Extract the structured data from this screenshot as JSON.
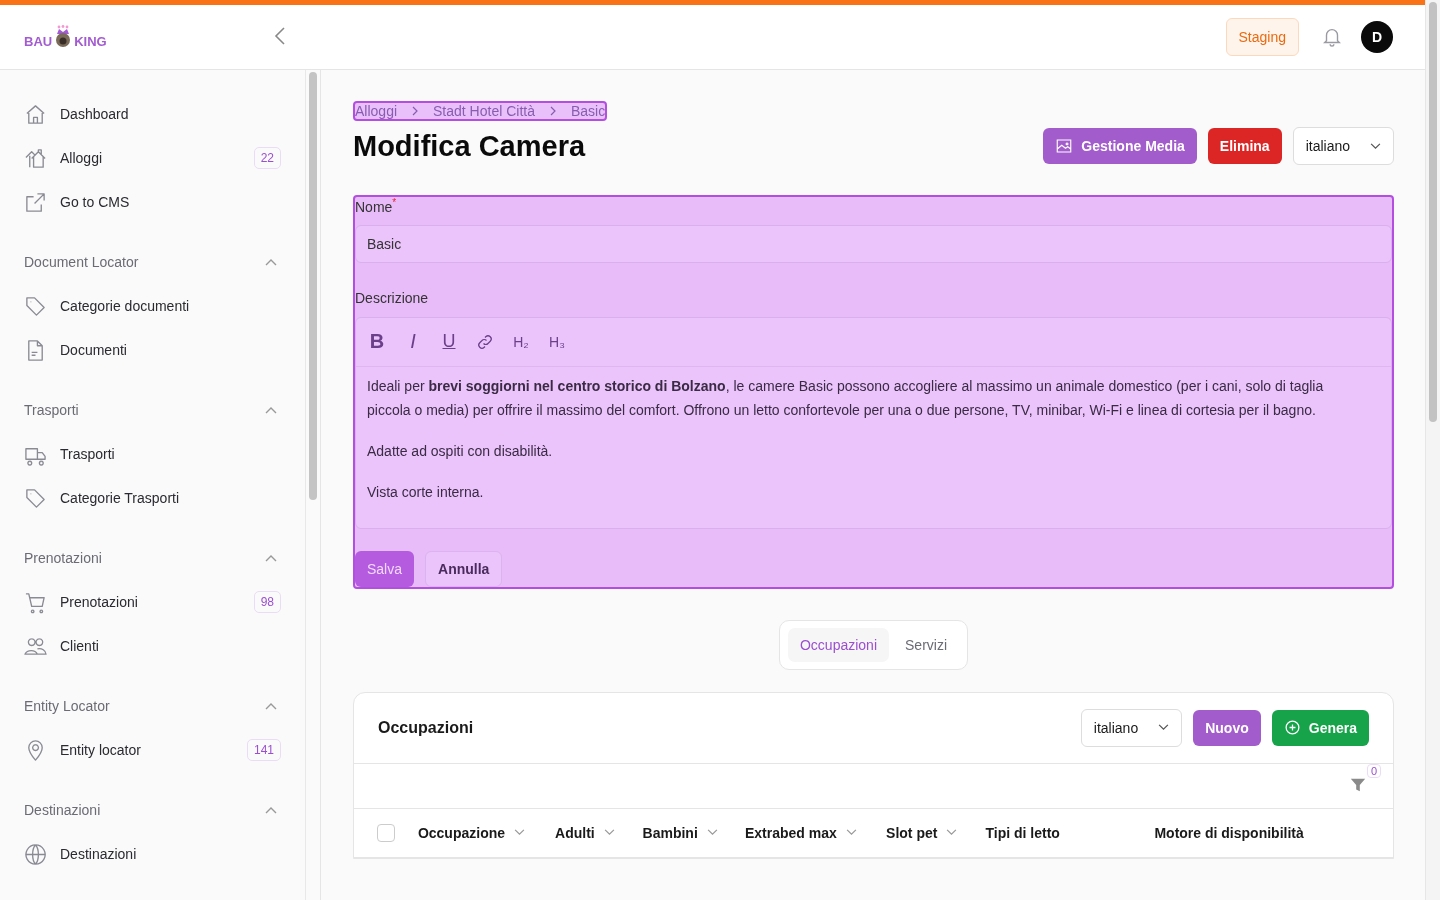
{
  "topbar": {
    "logo": {
      "left": "BAU",
      "right": "KING"
    },
    "environment": "Staging",
    "avatar": "D"
  },
  "sidebar": {
    "groups": [
      {
        "items": [
          {
            "kind": "home",
            "label": "Dashboard"
          },
          {
            "kind": "homes",
            "label": "Alloggi",
            "count": "22"
          },
          {
            "kind": "external",
            "label": "Go to CMS"
          }
        ]
      },
      {
        "title": "Document Locator",
        "expanded": true,
        "items": [
          {
            "kind": "tag",
            "label": "Categorie documenti"
          },
          {
            "kind": "file",
            "label": "Documenti"
          }
        ]
      },
      {
        "title": "Trasporti",
        "expanded": true,
        "items": [
          {
            "kind": "truck",
            "label": "Trasporti"
          },
          {
            "kind": "tag",
            "label": "Categorie Trasporti"
          }
        ]
      },
      {
        "title": "Prenotazioni",
        "expanded": true,
        "items": [
          {
            "kind": "cart",
            "label": "Prenotazioni",
            "count": "98"
          },
          {
            "kind": "users",
            "label": "Clienti"
          }
        ]
      },
      {
        "title": "Entity Locator",
        "expanded": true,
        "items": [
          {
            "kind": "pin",
            "label": "Entity locator",
            "count": "141"
          }
        ]
      },
      {
        "title": "Destinazioni",
        "expanded": true,
        "items": [
          {
            "kind": "globe",
            "label": "Destinazioni"
          }
        ]
      }
    ]
  },
  "breadcrumb": [
    "Alloggi",
    "Stadt Hotel Città",
    "Basic"
  ],
  "page": {
    "title": "Modifica Camera",
    "media_button": "Gestione Media",
    "delete_button": "Elimina",
    "language": "italiano"
  },
  "form": {
    "highlighted": true,
    "name": {
      "label": "Nome",
      "required_mark": "*",
      "value": "Basic"
    },
    "description": {
      "label": "Descrizione",
      "toolbar": [
        {
          "kind": "bold",
          "label": "B"
        },
        {
          "kind": "italic",
          "label": "I"
        },
        {
          "kind": "underline",
          "label": "U"
        },
        {
          "kind": "link"
        },
        {
          "kind": "heading",
          "label": "H₂"
        },
        {
          "kind": "heading",
          "label": "H₃"
        }
      ],
      "paragraphs": [
        "Ideali per **brevi soggiorni nel centro storico di Bolzano**, le camere Basic possono accogliere al massimo un animale domestico (per i cani, solo di taglia piccola o media) per offrire il massimo del comfort. Offrono un letto confortevole per una o due persone, TV, minibar, Wi-Fi e linea di cortesia per il bagno.",
        "Adatte ad ospiti con disabilità.",
        "Vista corte interna."
      ]
    },
    "save_button": "Salva",
    "cancel_button": "Annulla"
  },
  "tabs": [
    {
      "label": "Occupazioni",
      "selected": true
    },
    {
      "label": "Servizi",
      "selected": false
    }
  ],
  "panel": {
    "title": "Occupazioni",
    "language": "italiano",
    "new_button": "Nuovo",
    "generate_button": "Genera",
    "filter_count": "0",
    "select_all": {
      "checked": false
    },
    "columns": [
      {
        "label": "Occupazione",
        "sortable": true
      },
      {
        "label": "Adulti",
        "sortable": true
      },
      {
        "label": "Bambini",
        "sortable": true
      },
      {
        "label": "Extrabed max",
        "sortable": true
      },
      {
        "label": "Slot pet",
        "sortable": true
      },
      {
        "label": "Tipi di letto",
        "sortable": false
      },
      {
        "label": "Motore di disponibilità",
        "sortable": false
      }
    ]
  }
}
